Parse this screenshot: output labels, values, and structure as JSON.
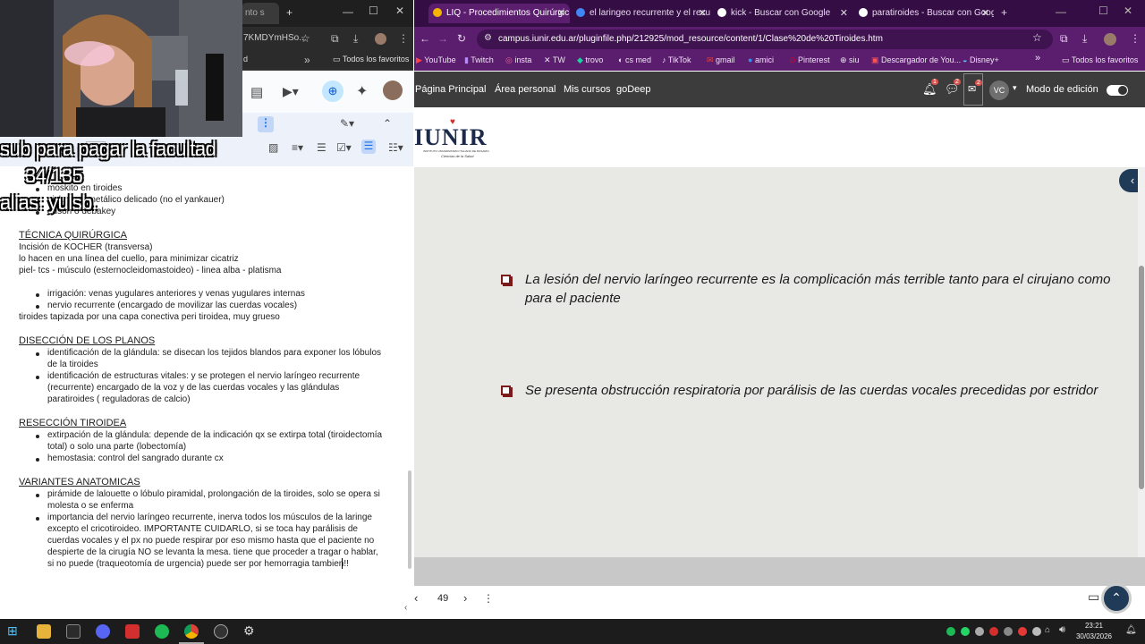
{
  "left": {
    "tab_title": "nto s",
    "url_partial": "7KMDYmHSo...",
    "bookmark_partial": "d",
    "font_size": "11",
    "overlay": {
      "line1": "sub para pagar la facultad",
      "line2": "34/135",
      "line3": "alias: yulsb."
    },
    "doc": {
      "top_items": [
        "moskito en tiroides",
        "pick... .on metálico delicado (no el yankauer)",
        "adson o debakey"
      ],
      "s1_title": "TÉCNICA QUIRÚRGICA",
      "s1_lines": [
        "Incisión de KOCHER (transversa)",
        "lo hacen en una línea del cuello, para minimizar cicatriz",
        "piel- tcs - músculo (esternocleidomastoideo) - linea alba - platisma"
      ],
      "s1_bullets": [
        "irrigación: venas yugulares anteriores y venas yugulares internas",
        "nervio recurrente (encargado de movilizar las cuerdas vocales)"
      ],
      "s1_after": "tiroides tapizada por una capa conectiva peri tiroidea, muy grueso",
      "s2_title": "DISECCIÓN DE LOS PLANOS",
      "s2_b1": [
        "identificación de la glándula: se disecan los tejidos blandos para exponer los lóbulos",
        "de la tiroides"
      ],
      "s2_b2": [
        "identificación de estructuras vitales: y se protegen el nervio laríngeo recurrente",
        "(recurrente) encargado de la voz y de las cuerdas vocales y las glándulas",
        "paratiroides ( reguladoras de calcio)"
      ],
      "s3_title": "RESECCIÓN TIROIDEA",
      "s3_b1": [
        "extirpación de la glándula: depende de la indicación qx se extirpa total (tiroidectomía",
        "total) o solo una parte (lobectomía)"
      ],
      "s3_b2": [
        "hemostasia: control del sangrado durante cx"
      ],
      "s4_title": "VARIANTES ANATOMICAS",
      "s4_b1": [
        "pirámide de lalouette o lóbulo piramidal, prolongación de la tiroides, solo se opera si",
        "molesta o se enferma"
      ],
      "s4_b2": [
        "importancia del nervio laríngeo recurrente, inerva todos los músculos de la laringe",
        "excepto el cricotiroideo. IMPORTANTE CUIDARLO, si se toca hay parálisis de",
        "cuerdas vocales y el px no puede respirar por eso mismo hasta que el paciente no",
        "despierte de la cirugía NO se levanta la mesa. tiene que proceder a tragar o hablar,",
        "si no puede (traqueotomía de urgencia) puede ser por hemorragia tambien!!"
      ]
    }
  },
  "right": {
    "tabs": [
      {
        "label": "LIQ - Procedimientos Quirúrgic",
        "active": true,
        "fav_color": "#f4b400"
      },
      {
        "label": "el laringeo recurrente y el recu",
        "active": false,
        "fav_color": "#4285f4"
      },
      {
        "label": "kick - Buscar con Google",
        "active": false,
        "fav_color": "#ffffff"
      },
      {
        "label": "paratiroides - Buscar con Googl",
        "active": false,
        "fav_color": "#ffffff"
      }
    ],
    "url": "campus.iunir.edu.ar/pluginfile.php/212925/mod_resource/content/1/Clase%20de%20Tiroides.htm",
    "bookmarks": [
      "YouTube",
      "Twitch",
      "insta",
      "TW",
      "trovo",
      "cs med",
      "TikTok",
      "gmail",
      "amici",
      "Pinterest",
      "siu",
      "Descargador de You...",
      "Disney+"
    ],
    "bookmarks_all": "Todos los favoritos",
    "bookmarks_all_left": "Todos los favoritos",
    "nav": {
      "home": "Página Principal",
      "personal": "Área personal",
      "courses": "Mis cursos",
      "godeep": "goDeep",
      "notif_count": "1",
      "msg_count": "2",
      "mail_count": "2",
      "avatar": "VC",
      "edit_mode": "Modo de edición"
    },
    "logo": {
      "text": "IUNIR",
      "sub1": "INSTITUTO UNIVERSITARIO ITALIANO DE ROSARIO",
      "sub2": "Ciencias de la Salud"
    },
    "slide": {
      "p1": [
        "La lesión del nervio laríngeo recurrente es la complicación más terrible tanto para el cirujano como",
        "para el paciente"
      ],
      "p2": "Se presenta obstrucción respiratoria por parálisis de las cuerdas vocales precedidas por estridor"
    },
    "pdf": {
      "page": "49"
    }
  },
  "taskbar": {
    "time": "23:21",
    "date": "30/03/2026",
    "colors": {
      "accent": "#5b1d6e",
      "spotify": "#1db954",
      "discord": "#5865f2",
      "chrome": "#db4437"
    }
  }
}
